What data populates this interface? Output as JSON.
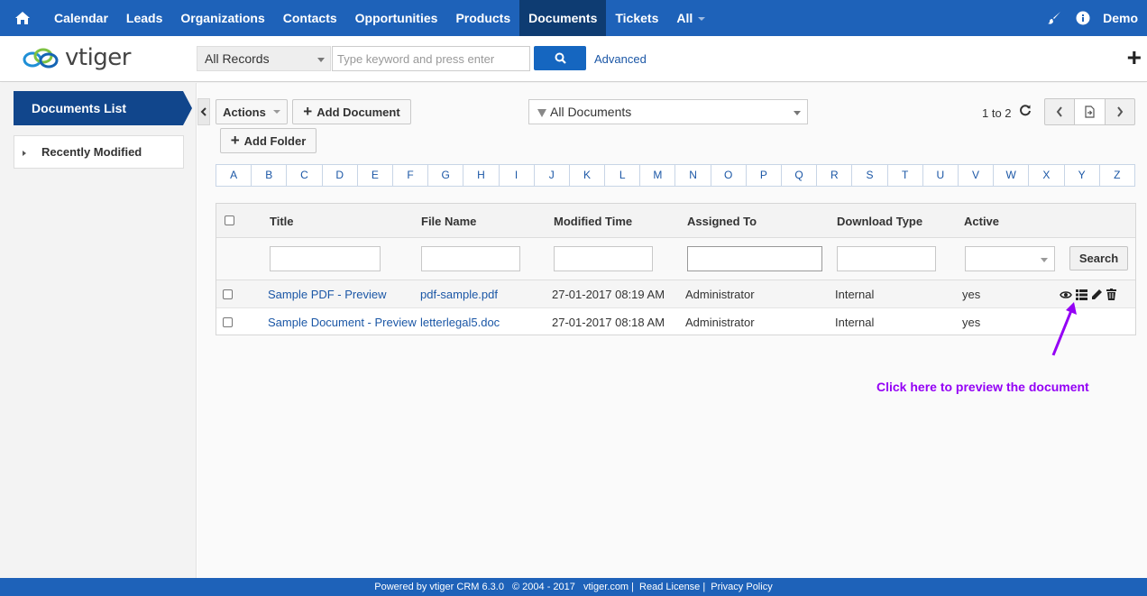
{
  "topnav": {
    "items": [
      "Calendar",
      "Leads",
      "Organizations",
      "Contacts",
      "Opportunities",
      "Products",
      "Documents",
      "Tickets",
      "All"
    ],
    "active": "Documents",
    "user": "Demo"
  },
  "header": {
    "logo_text": "vtiger",
    "record_select": "All Records",
    "search_placeholder": "Type keyword and press enter",
    "advanced_label": "Advanced"
  },
  "sidebar": {
    "documents_list": "Documents List",
    "recently_modified": "Recently Modified"
  },
  "toolbar": {
    "actions_label": "Actions",
    "add_document_label": "Add Document",
    "add_folder_label": "Add Folder",
    "filter_label": "All Documents",
    "pagination_text": "1 to 2"
  },
  "alphabet": [
    "A",
    "B",
    "C",
    "D",
    "E",
    "F",
    "G",
    "H",
    "I",
    "J",
    "K",
    "L",
    "M",
    "N",
    "O",
    "P",
    "Q",
    "R",
    "S",
    "T",
    "U",
    "V",
    "W",
    "X",
    "Y",
    "Z"
  ],
  "table": {
    "columns": [
      "Title",
      "File Name",
      "Modified Time",
      "Assigned To",
      "Download Type",
      "Active"
    ],
    "search_label": "Search",
    "rows": [
      {
        "title": "Sample PDF - Preview",
        "file": "pdf-sample.pdf",
        "modified": "27-01-2017 08:19 AM",
        "assigned": "Administrator",
        "download": "Internal",
        "active": "yes"
      },
      {
        "title": "Sample Document - Preview",
        "file": "letterlegal5.doc",
        "modified": "27-01-2017 08:18 AM",
        "assigned": "Administrator",
        "download": "Internal",
        "active": "yes"
      }
    ]
  },
  "annotation": {
    "text": "Click here to preview the document",
    "color": "#9400f5"
  },
  "footer": {
    "powered": "Powered by vtiger CRM 6.3.0",
    "copyright": "© 2004 - 2017",
    "site": "vtiger.com",
    "license": "Read License",
    "privacy": "Privacy Policy"
  },
  "colors": {
    "nav_bg": "#1e62b9",
    "nav_active": "#0e3c72",
    "link": "#1b57a6",
    "sidebar_tab": "#11468c"
  }
}
